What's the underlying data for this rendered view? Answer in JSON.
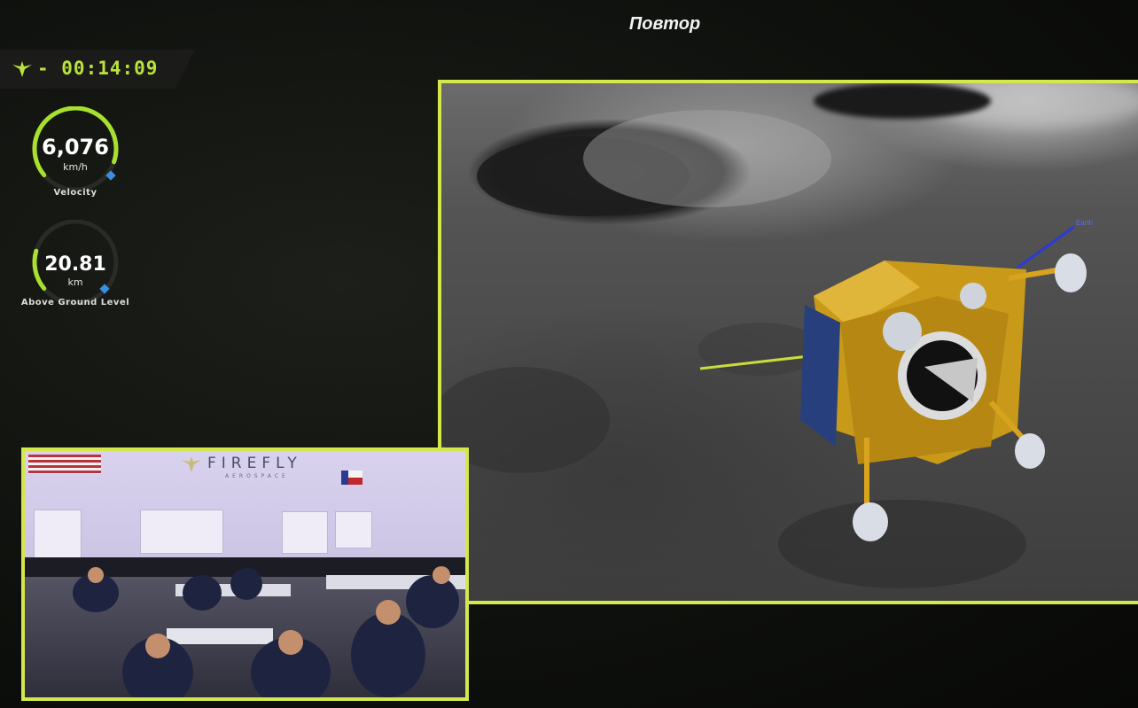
{
  "header": {
    "replay_label": "Повтор"
  },
  "mission": {
    "timer": "- 00:14:09",
    "logo_icon": "firefly-logo-icon"
  },
  "telemetry": {
    "velocity": {
      "value": "6,076",
      "unit": "km/h",
      "caption": "Velocity",
      "level": 0.85
    },
    "altitude": {
      "value": "20.81",
      "unit": "km",
      "caption": "Above Ground Level",
      "level": 0.2
    }
  },
  "scene": {
    "earth_label": "Earth"
  },
  "camera": {
    "wall_title": "FIREFLY",
    "wall_subtitle": "AEROSPACE"
  },
  "colors": {
    "accent": "#d4e84a",
    "gauge_green": "#a8e02e",
    "gauge_blue": "#3a8fe0"
  }
}
